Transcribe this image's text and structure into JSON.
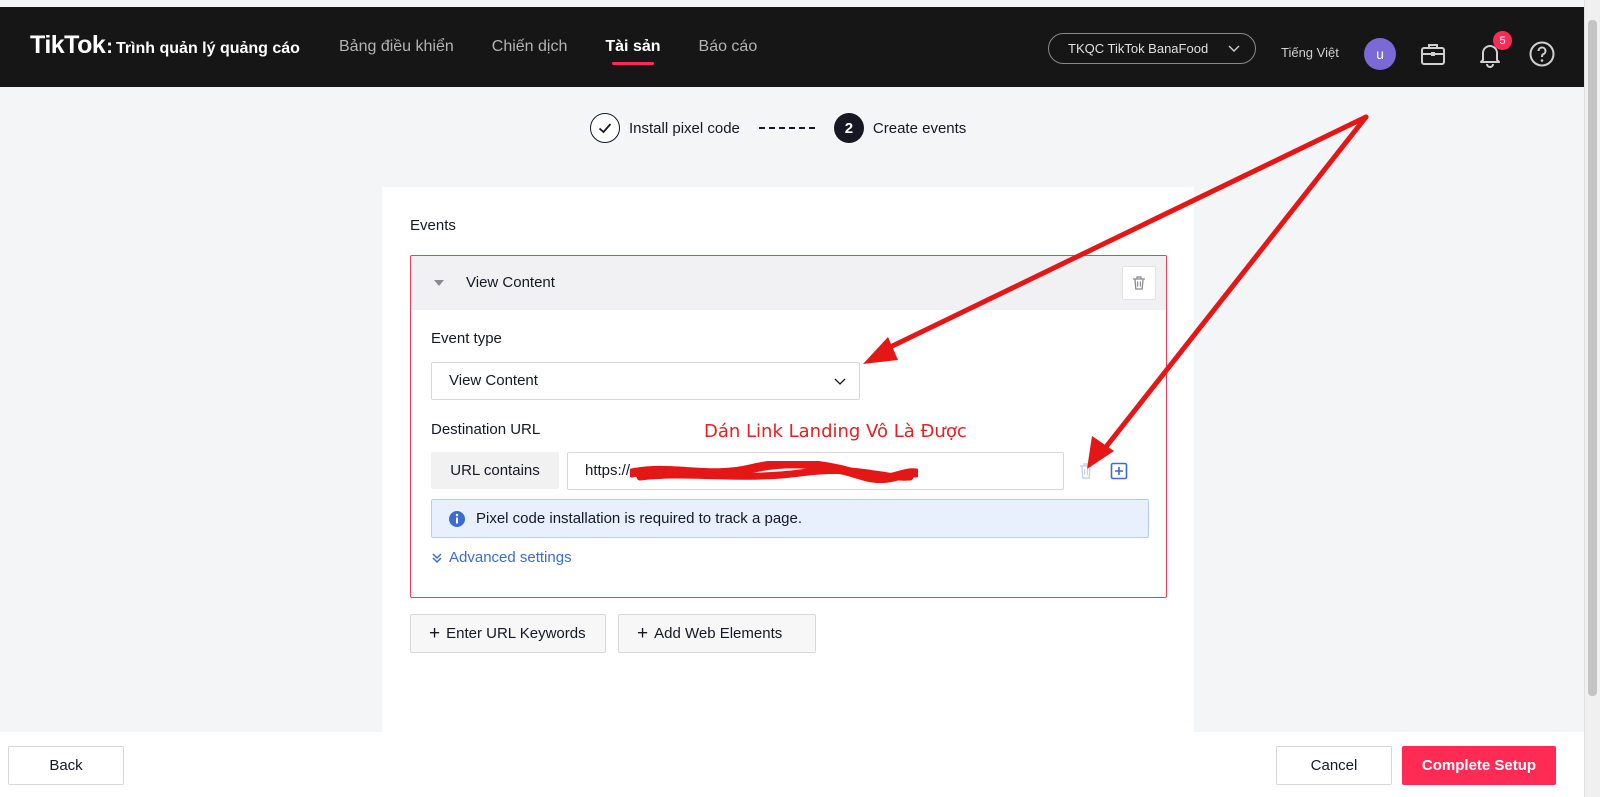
{
  "header": {
    "logo_word": "TikTok",
    "logo_colon": ":",
    "logo_subtitle": "Trình quản lý quảng cáo",
    "nav": [
      {
        "label": "Bảng điều khiển",
        "active": false
      },
      {
        "label": "Chiến dịch",
        "active": false
      },
      {
        "label": "Tài sản",
        "active": true
      },
      {
        "label": "Báo cáo",
        "active": false
      }
    ],
    "account_name": "TKQC TikTok BanaFood",
    "language": "Tiếng Việt",
    "avatar_initial": "u",
    "notification_count": "5",
    "icons": [
      "briefcase-icon",
      "bell-icon",
      "help-icon"
    ]
  },
  "stepper": {
    "steps": [
      {
        "label": "Install pixel code",
        "state": "done"
      },
      {
        "number": "2",
        "label": "Create events",
        "state": "current"
      }
    ]
  },
  "events": {
    "title": "Events",
    "items": [
      {
        "name": "View Content",
        "event_type_label": "Event type",
        "event_type_value": "View Content",
        "destination_label": "Destination URL",
        "match_type": "URL contains",
        "url_value": "https://",
        "notice": "Pixel code installation is required to track a page.",
        "advanced_settings": "Advanced settings"
      }
    ],
    "add_buttons": {
      "url_keywords": "Enter URL Keywords",
      "web_elements": "Add Web Elements"
    }
  },
  "footer": {
    "back": "Back",
    "cancel": "Cancel",
    "complete": "Complete Setup"
  },
  "annotation": {
    "text": "Dán Link Landing Vô Là Được",
    "color": "#e52020"
  },
  "colors": {
    "brand_accent": "#fe2c55",
    "link": "#3c6ccf",
    "topbar": "#161616",
    "panel_border": "#ef3e5c"
  }
}
